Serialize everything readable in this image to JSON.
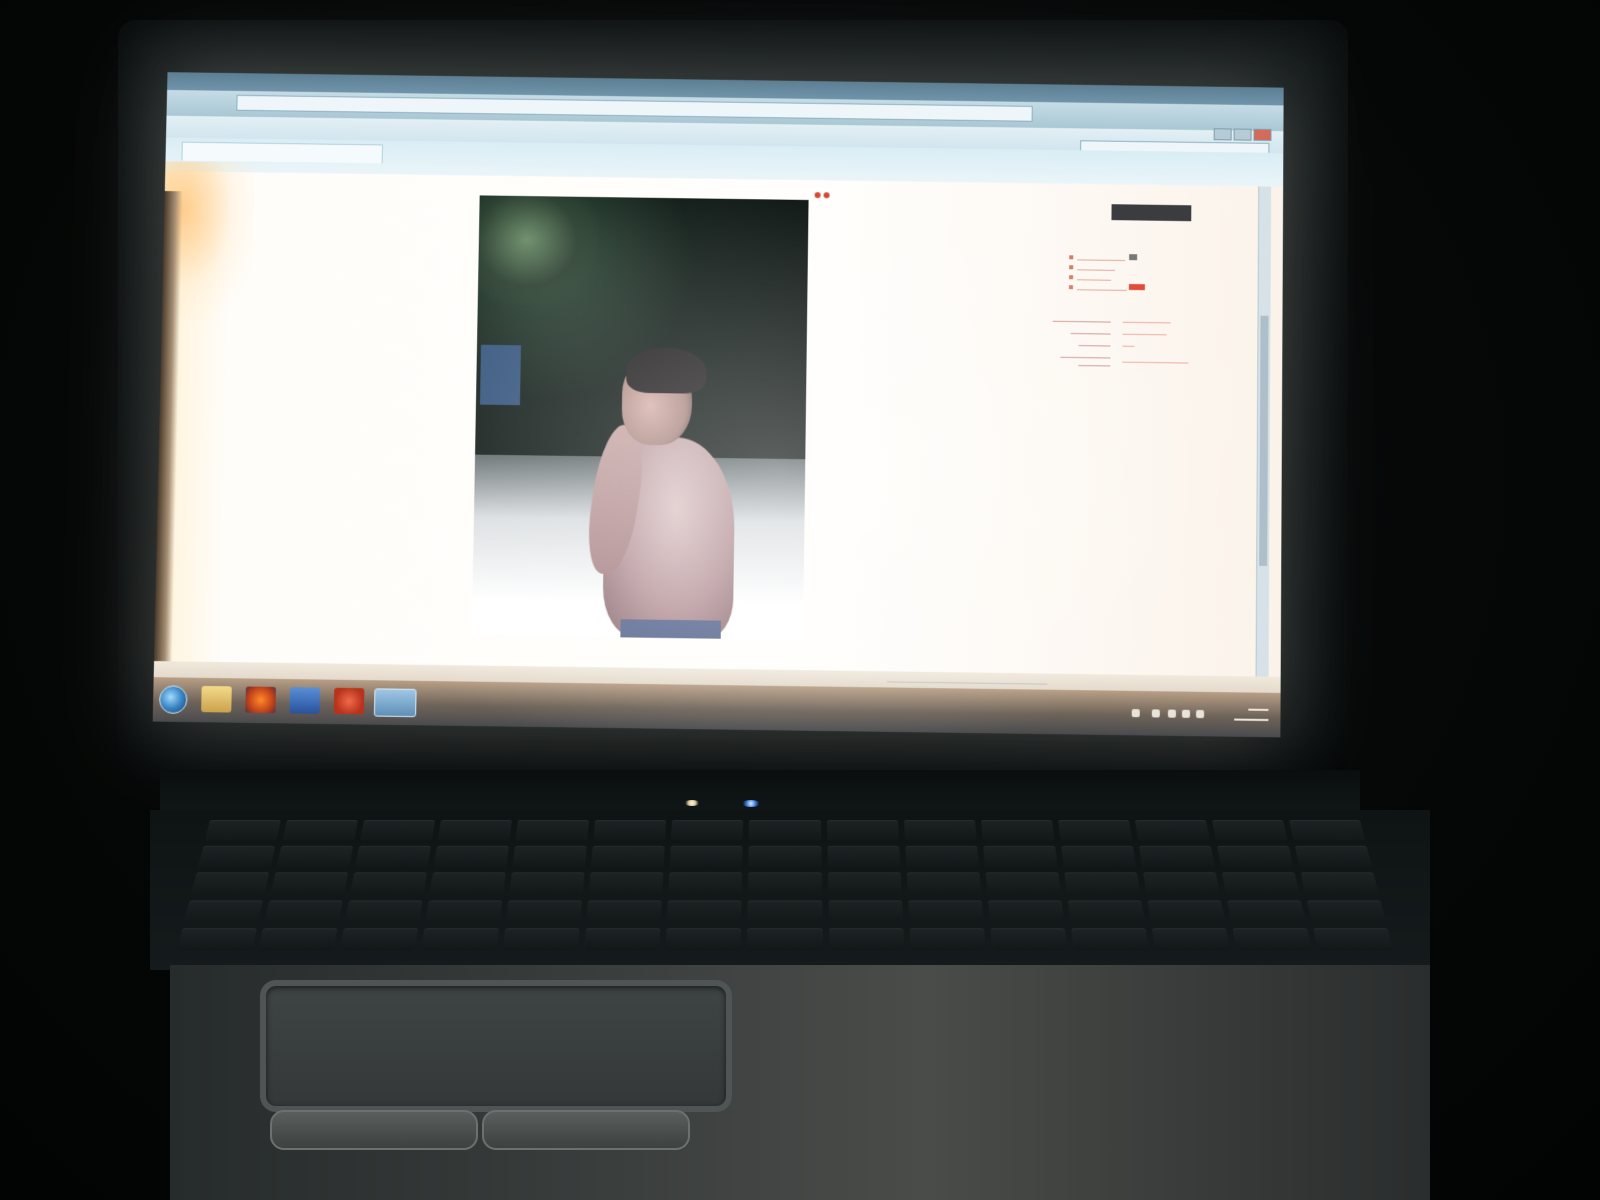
{
  "scene": {
    "description_type": "photo-of-laptop-screen",
    "colors": {
      "page_background": "#fffefc",
      "link_color": "#c45a4a",
      "badge_color": "#e04a3a",
      "chrome_blue": "#a9c7d4",
      "taskbar": "#6e6359"
    }
  },
  "browser": {
    "address_icon": "globe-icon",
    "search_icon": "search-icon"
  },
  "taskbar": {
    "start_icon": "windows-start-icon",
    "apps": [
      {
        "icon": "folder-icon"
      },
      {
        "icon": "firefox-icon"
      },
      {
        "icon": "app-icon"
      },
      {
        "icon": "opera-icon"
      },
      {
        "icon": "internet-explorer-icon"
      }
    ]
  },
  "laptop": {
    "leds": [
      "power-led",
      "wifi-led"
    ]
  }
}
